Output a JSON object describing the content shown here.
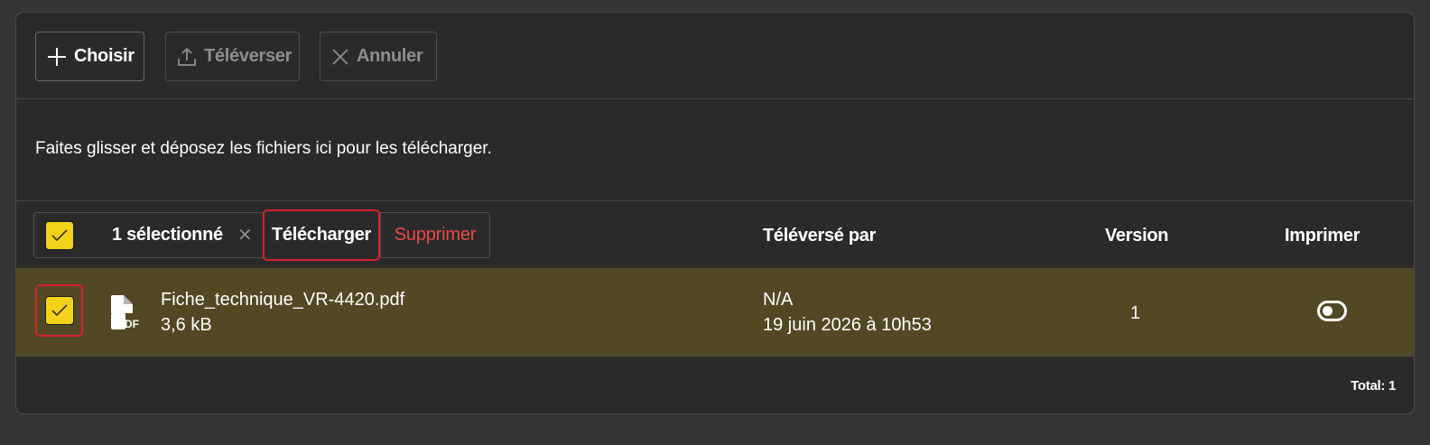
{
  "toolbar": {
    "choose_label": "Choisir",
    "upload_label": "Téléverser",
    "cancel_label": "Annuler"
  },
  "dropzone": {
    "message": "Faites glisser et déposez les fichiers ici pour les télécharger."
  },
  "table": {
    "bulk": {
      "selected_count": "1 sélectionné",
      "download_label": "Télécharger",
      "delete_label": "Supprimer"
    },
    "headers": {
      "uploaded_by": "Téléversé par",
      "version": "Version",
      "print": "Imprimer"
    },
    "rows": [
      {
        "file_name": "Fiche_technique_VR-4420.pdf",
        "file_size": "3,6 kB",
        "file_type": "PDF",
        "uploaded_by": "N/A",
        "uploaded_at": "19 juin 2026 à 10h53",
        "version": "1",
        "print_enabled": false,
        "selected": true
      }
    ],
    "total": "Total: 1"
  },
  "colors": {
    "accent_yellow": "#f3d31a",
    "highlight_red": "#d8222a",
    "delete_red": "#ef4a4a",
    "row_selected_bg": "#524824",
    "panel_bg": "#2a2a2a"
  }
}
